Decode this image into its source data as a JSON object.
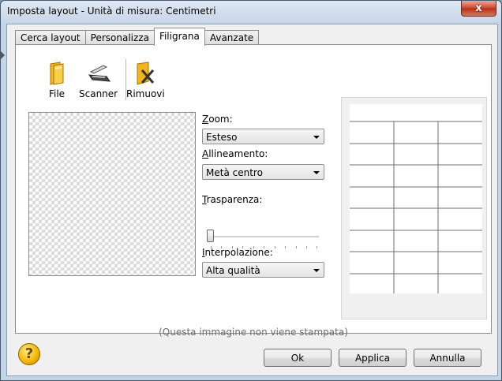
{
  "window": {
    "title": "Imposta layout - Unità di misura: Centimetri",
    "close_glyph": "x"
  },
  "tabs": [
    {
      "label": "Cerca layout",
      "active": false
    },
    {
      "label": "Personalizza",
      "active": false
    },
    {
      "label": "Filigrana",
      "active": true
    },
    {
      "label": "Avanzate",
      "active": false
    }
  ],
  "toolbar": {
    "file_label": "File",
    "scanner_label": "Scanner",
    "remove_label": "Rimuovi"
  },
  "zoom": {
    "label_prefix": "Z",
    "label_rest": "oom:",
    "value": "Esteso"
  },
  "align": {
    "label_prefix": "A",
    "label_rest": "llineamento:",
    "value": "Metà centro"
  },
  "transparency": {
    "label_prefix": "T",
    "label_rest": "rasparenza:",
    "level": 0
  },
  "interpolation": {
    "label_prefix": "I",
    "label_rest": "nterpolazione:",
    "value": "Alta qualità"
  },
  "note": "(Questa immagine non viene stampata)",
  "buttons": {
    "ok": "Ok",
    "apply": "Applica",
    "cancel": "Annulla"
  },
  "help_glyph": "?",
  "colors": {
    "accent": "#c9462c",
    "help": "#f4b400",
    "border": "#898c95"
  }
}
